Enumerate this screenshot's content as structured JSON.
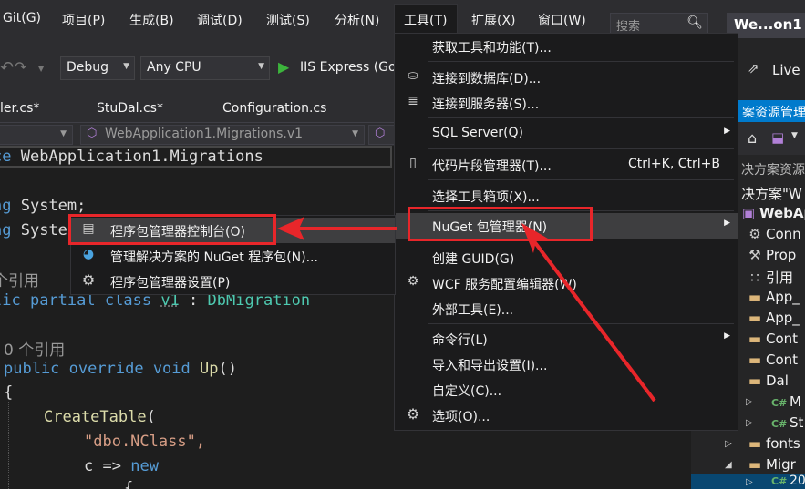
{
  "menubar": {
    "items": [
      "Git(G)",
      "项目(P)",
      "生成(B)",
      "调试(D)",
      "测试(S)",
      "分析(N)",
      "工具(T)",
      "扩展(X)",
      "窗口(W)"
    ],
    "search_placeholder": "搜索",
    "window_title": "We...on1"
  },
  "toolbar": {
    "config": "Debug",
    "platform": "Any CPU",
    "run_label": "IIS Express (Go",
    "live_share": "Live S"
  },
  "tabs": [
    "ler.cs*",
    "StuDal.cs*",
    "Configuration.cs"
  ],
  "nav": {
    "project": "WebApplication1.Migrations.v1"
  },
  "code": {
    "line1_kw": "ce",
    "line1_ns": "WebApplication1.Migrations",
    "line2_kw": "ng",
    "line2_txt": "System;",
    "line3_kw": "ng",
    "line3_txt": "Syste",
    "refs1": "个引用",
    "class_line_kw1": "lic",
    "class_line_kw2": "partial",
    "class_line_kw3": "class",
    "class_line_name": "v1",
    "class_line_colon": ":",
    "class_line_base": "DbMigration",
    "refs2": "0 个引用",
    "method_kw1": "public",
    "method_kw2": "override",
    "method_kw3": "void",
    "method_name": "Up",
    "method_parens": "()",
    "brace_open": "{",
    "call_name": "CreateTable",
    "call_paren": "(",
    "table_name": "\"dbo.NClass\",",
    "lambda_param": "c",
    "lambda_arrow": "=>",
    "lambda_new": "new",
    "brace_open2": "{"
  },
  "tools_menu": {
    "items": [
      {
        "label": "获取工具和功能(T)...",
        "icon": "",
        "shortcut": "",
        "submenu": false
      },
      {
        "label": "连接到数据库(D)...",
        "icon": "database-plus-icon",
        "shortcut": "",
        "submenu": false
      },
      {
        "label": "连接到服务器(S)...",
        "icon": "server-plus-icon",
        "shortcut": "",
        "submenu": false
      },
      {
        "label": "SQL Server(Q)",
        "icon": "",
        "shortcut": "",
        "submenu": true
      },
      {
        "label": "代码片段管理器(T)...",
        "icon": "snippet-icon",
        "shortcut": "Ctrl+K, Ctrl+B",
        "submenu": false
      },
      {
        "label": "选择工具箱项(X)...",
        "icon": "",
        "shortcut": "",
        "submenu": false
      },
      {
        "label": "NuGet 包管理器(N)",
        "icon": "",
        "shortcut": "",
        "submenu": true
      },
      {
        "label": "创建 GUID(G)",
        "icon": "",
        "shortcut": "",
        "submenu": false
      },
      {
        "label": "WCF 服务配置编辑器(W)",
        "icon": "wcf-gear-icon",
        "shortcut": "",
        "submenu": false
      },
      {
        "label": "外部工具(E)...",
        "icon": "",
        "shortcut": "",
        "submenu": false
      },
      {
        "label": "命令行(L)",
        "icon": "",
        "shortcut": "",
        "submenu": true
      },
      {
        "label": "导入和导出设置(I)...",
        "icon": "",
        "shortcut": "",
        "submenu": false
      },
      {
        "label": "自定义(C)...",
        "icon": "",
        "shortcut": "",
        "submenu": false
      },
      {
        "label": "选项(O)...",
        "icon": "gear-icon",
        "shortcut": "",
        "submenu": false
      }
    ]
  },
  "nuget_submenu": {
    "items": [
      {
        "label": "程序包管理器控制台(O)",
        "icon": "console-icon"
      },
      {
        "label": "管理解决方案的 NuGet 程序包(N)...",
        "icon": "nuget-icon"
      },
      {
        "label": "程序包管理器设置(P)",
        "icon": "gear-icon"
      }
    ]
  },
  "solution_explorer": {
    "title": "案资源管理",
    "search_label": "决方案资源",
    "rows": [
      {
        "label": "决方案\"W",
        "icon": ""
      },
      {
        "label": "WebApp",
        "icon": "project-icon"
      },
      {
        "label": "Conn",
        "icon": "globe-icon"
      },
      {
        "label": "Prop",
        "icon": "wrench-icon"
      },
      {
        "label": "引用",
        "icon": "references-icon"
      },
      {
        "label": "App_",
        "icon": "folder-icon"
      },
      {
        "label": "App_",
        "icon": "folder-icon"
      },
      {
        "label": "Cont",
        "icon": "folder-icon"
      },
      {
        "label": "Cont",
        "icon": "folder-icon"
      },
      {
        "label": "Dal",
        "icon": "folder-icon"
      },
      {
        "label": "M",
        "icon": "csharp-file-icon"
      },
      {
        "label": "St",
        "icon": "csharp-file-icon"
      },
      {
        "label": "fonts",
        "icon": "folder-icon"
      },
      {
        "label": "Migr",
        "icon": "folder-icon"
      },
      {
        "label": "20",
        "icon": "csharp-file-icon"
      }
    ]
  },
  "colors": {
    "accent": "#007acc",
    "annotation_red": "#e8262a",
    "menu_bg": "#1b1b1c",
    "editor_bg": "#1e1e1e"
  }
}
